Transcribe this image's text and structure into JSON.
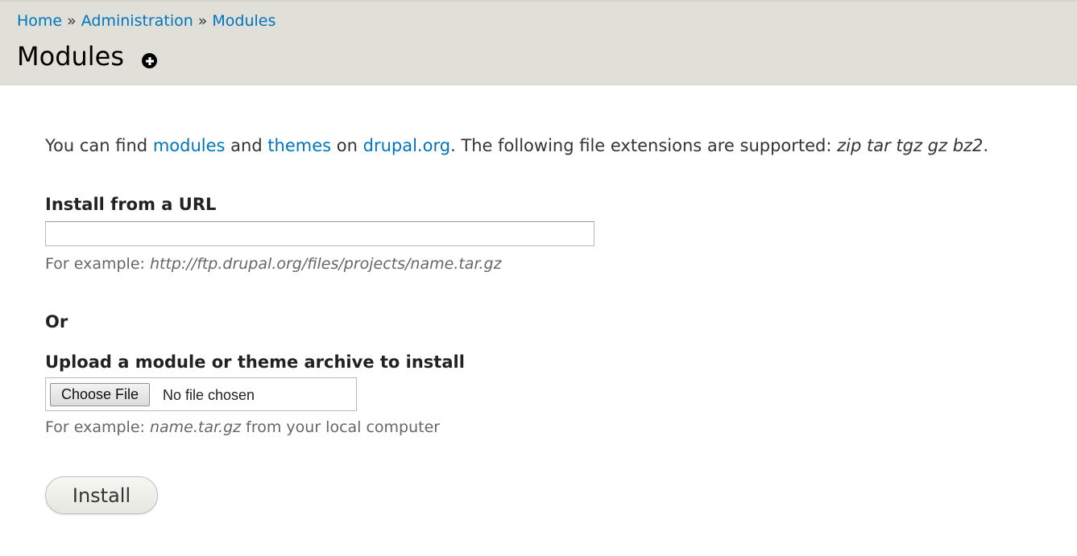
{
  "breadcrumb": {
    "items": [
      "Home",
      "Administration",
      "Modules"
    ],
    "separator": "»"
  },
  "page": {
    "title": "Modules",
    "add_icon": "plus-circle-icon"
  },
  "help": {
    "prefix": "You can find ",
    "modules_link": "modules",
    "and": " and ",
    "themes_link": "themes",
    "on": " on ",
    "drupal_link": "drupal.org",
    "suffix": ". The following file extensions are supported: ",
    "extensions": "zip tar tgz gz bz2",
    "end": "."
  },
  "url_field": {
    "label": "Install from a URL",
    "value": "",
    "desc_prefix": "For example: ",
    "desc_example": "http://ftp.drupal.org/files/projects/name.tar.gz"
  },
  "or_text": "Or",
  "upload_field": {
    "label": "Upload a module or theme archive to install",
    "button_label": "Choose File",
    "status": "No file chosen",
    "desc_prefix": "For example: ",
    "desc_example": "name.tar.gz",
    "desc_suffix": " from your local computer"
  },
  "install_button": "Install",
  "colors": {
    "header_bg": "#e0e0d8",
    "link": "#0074bd"
  }
}
